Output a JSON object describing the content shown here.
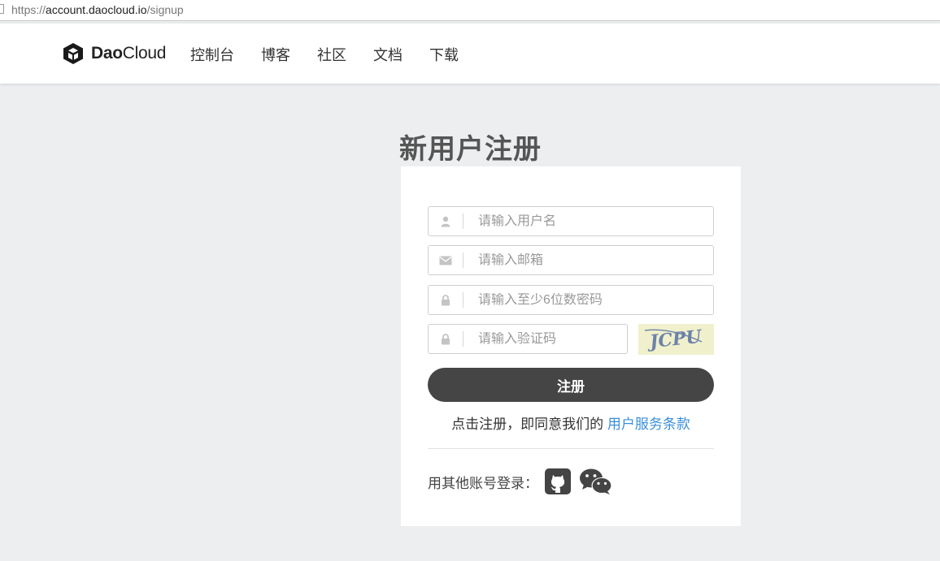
{
  "browser": {
    "url_prefix": "https://",
    "url_host": "account.daocloud.io",
    "url_path": "/signup"
  },
  "header": {
    "logo": {
      "icon": "daocloud-cube-logo",
      "brand_bold": "Dao",
      "brand_light": "Cloud"
    },
    "nav": [
      {
        "label": "控制台"
      },
      {
        "label": "博客"
      },
      {
        "label": "社区"
      },
      {
        "label": "文档"
      },
      {
        "label": "下载"
      }
    ]
  },
  "signup": {
    "title": "新用户注册",
    "fields": {
      "username": {
        "placeholder": "请输入用户名",
        "value": "",
        "icon": "user-icon"
      },
      "email": {
        "placeholder": "请输入邮箱",
        "value": "",
        "icon": "envelope-icon"
      },
      "password": {
        "placeholder": "请输入至少6位数密码",
        "value": "",
        "icon": "lock-icon"
      },
      "captcha": {
        "placeholder": "请输入验证码",
        "value": "",
        "icon": "lock-icon"
      }
    },
    "captcha_image": {
      "text": "JCPU"
    },
    "submit_label": "注册",
    "agreement_text": "点击注册，即同意我们的",
    "agreement_link": "用户服务条款",
    "social_label": "用其他账号登录：",
    "social": [
      {
        "name": "GitHub",
        "icon": "github-icon"
      },
      {
        "name": "WeChat",
        "icon": "wechat-icon"
      }
    ]
  },
  "colors": {
    "page_bg": "#eceeef",
    "primary_button": "#454545",
    "link": "#3a8fd9",
    "placeholder": "#999999"
  }
}
